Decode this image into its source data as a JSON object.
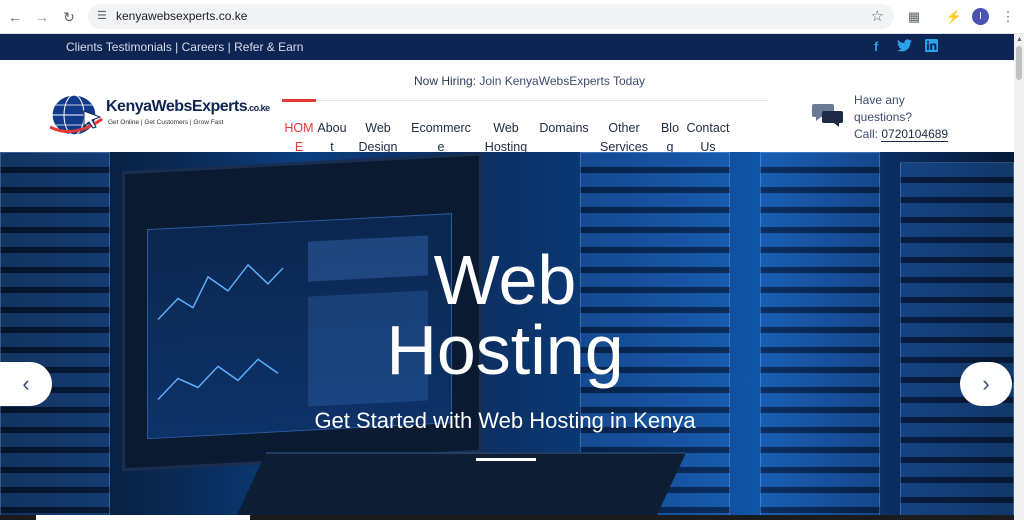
{
  "browser": {
    "url": "kenyawebsexperts.co.ke",
    "profile_initial": "I",
    "icons": [
      "back-icon",
      "forward-icon",
      "reload-icon",
      "site-info-icon",
      "bookmark-star-icon",
      "extensions-icon",
      "performance-icon",
      "menu-icon"
    ]
  },
  "topbar": {
    "link1": "Clients Testimonials",
    "sep": " | ",
    "link2": "Careers",
    "link3": "Refer & Earn",
    "social": [
      "f",
      "twitter",
      "in"
    ],
    "bg_color": "#0e2453"
  },
  "header": {
    "hiring_label": "Now Hiring:",
    "hiring_link": "Join KenyaWebsExperts Today",
    "logo_name": "KenyaWebsExperts",
    "logo_tld": ".co.ke",
    "logo_tagline": "Get Online | Get Customers | Grow Fast",
    "contact_line1": "Have any",
    "contact_line2": "questions?",
    "contact_call": "Call:",
    "contact_phone": "0720104689",
    "accent_color": "#e53935"
  },
  "menu": [
    {
      "label": "HOME",
      "active": true
    },
    {
      "label": "About",
      "active": false
    },
    {
      "label": "Web Design",
      "active": false
    },
    {
      "label": "Ecommerce",
      "active": false
    },
    {
      "label": "Web Hosting",
      "active": false
    },
    {
      "label": "Domains",
      "active": false
    },
    {
      "label": "Other Services",
      "active": false
    },
    {
      "label": "Blog",
      "active": false
    },
    {
      "label": "Contact Us",
      "active": false
    }
  ],
  "hero": {
    "title_line1": "Web",
    "title_line2": "Hosting",
    "subtitle": "Get Started with Web Hosting in Kenya",
    "prev_arrow": "‹",
    "next_arrow": "›"
  }
}
